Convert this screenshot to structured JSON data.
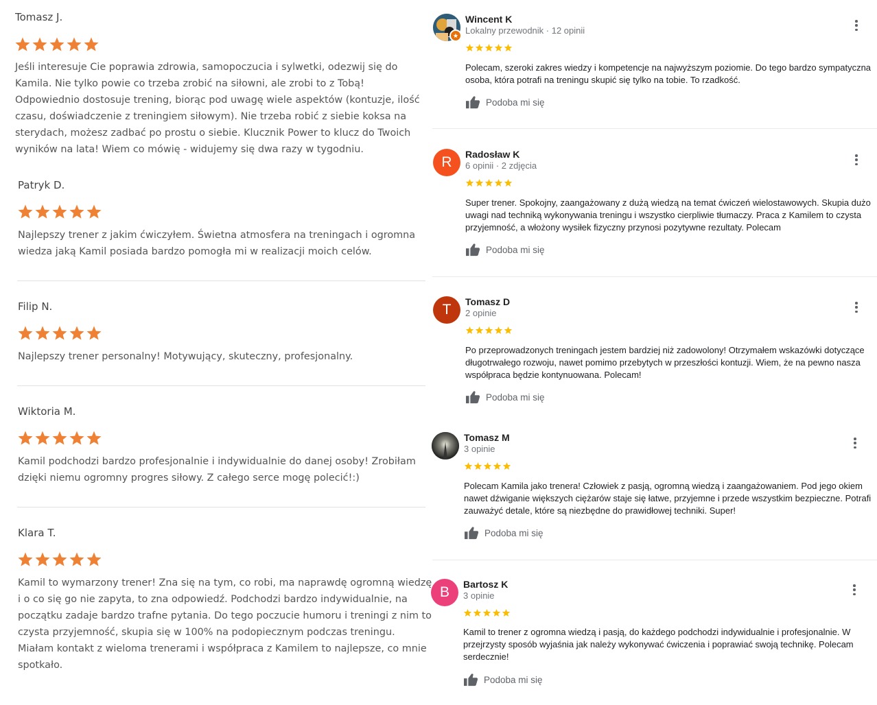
{
  "left_reviews": [
    {
      "name": "Tomasz J.",
      "rating": 5,
      "lines": [
        "Jeśli interesuje Cie poprawia zdrowia, samopoczucia i sylwetki, odezwij się do",
        "Kamila. Nie tylko powie co trzeba zrobić na siłowni, ale zrobi to z Tobą!",
        "Odpowiednio dostosuje trening, biorąc pod uwagę wiele aspektów (kontuzje, ilość",
        "czasu, doświadczenie z treningiem siłowym). Nie trzeba robić z siebie koksa na",
        "sterydach, możesz zadbać po prostu o siebie. Klucznik Power to klucz do Twoich",
        "wyników na lata! Wiem co mówię - widujemy się dwa razy w tygodniu."
      ]
    },
    {
      "name": "Patryk D.",
      "rating": 5,
      "lines": [
        "Najlepszy trener z jakim ćwiczyłem. Świetna atmosfera na treningach i ogromna",
        "wiedza jaką Kamil posiada bardzo pomogła mi w realizacji moich celów."
      ]
    },
    {
      "name": "Filip N.",
      "rating": 5,
      "lines": [
        "Najlepszy trener personalny! Motywujący, skuteczny, profesjonalny."
      ]
    },
    {
      "name": "Wiktoria M.",
      "rating": 5,
      "lines": [
        "Kamil podchodzi bardzo profesjonalnie i indywidualnie do danej osoby! Zrobiłam",
        "dzięki niemu ogromny progres siłowy. Z całego serce mogę polecić!:)"
      ]
    },
    {
      "name": "Klara T.",
      "rating": 5,
      "lines": [
        "Kamil to wymarzony trener! Zna się na tym, co robi, ma naprawdę ogromną wiedzę",
        "i o co się go nie zapyta, to zna odpowiedź. Podchodzi bardzo indywidualnie, na",
        "początku zadaje bardzo trafne pytania. Do tego poczucie humoru i treningi z nim to",
        "czysta przyjemność, skupia się w 100% na podopiecznym podczas treningu.",
        "Miałam kontakt z wieloma trenerami i współpraca z Kamilem to najlepsze, co mnie",
        "spotkało."
      ]
    }
  ],
  "right_reviews": [
    {
      "name": "Wincent K",
      "meta": "Lokalny przewodnik · 12 opinii",
      "avatar_letter": "",
      "avatar_color": "#3b6e8c",
      "rating": 5,
      "lines": [
        "Polecam, szeroki zakres wiedzy i kompetencje na najwyższym poziomie. Do tego bardzo sympatyczna",
        "osoba, która potrafi na treningu skupić się tylko na tobie. To rzadkość."
      ],
      "like_label": "Podoba mi się"
    },
    {
      "name": "Radosław K",
      "meta": "6 opinii · 2 zdjęcia",
      "avatar_letter": "R",
      "avatar_color": "#f4511e",
      "rating": 5,
      "lines": [
        "Super trener. Spokojny, zaangażowany z dużą wiedzą na temat ćwiczeń wielostawowych. Skupia dużo",
        "uwagi nad techniką wykonywania treningu i wszystko cierpliwie tłumaczy. Praca z Kamilem to czysta",
        "przyjemność, a włożony wysiłek fizyczny przynosi pozytywne rezultaty. Polecam"
      ],
      "like_label": "Podoba mi się"
    },
    {
      "name": "Tomasz D",
      "meta": "2 opinie",
      "avatar_letter": "T",
      "avatar_color": "#bf360c",
      "rating": 5,
      "lines": [
        "Po przeprowadzonych treningach jestem bardziej niż zadowolony! Otrzymałem wskazówki dotyczące",
        "długotrwałego rozwoju, nawet pomimo przebytych w przeszłości kontuzji. Wiem, że na pewno nasza",
        "współpraca będzie kontynuowana. Polecam!"
      ],
      "like_label": "Podoba mi się"
    },
    {
      "name": "Tomasz M",
      "meta": "3 opinie",
      "avatar_letter": "",
      "avatar_color": "#2b2b2b",
      "rating": 5,
      "lines": [
        "Polecam Kamila jako trenera! Człowiek z pasją, ogromną wiedzą i zaangażowaniem. Pod jego okiem",
        "nawet dźwiganie większych ciężarów staje się łatwe, przyjemne i przede wszystkim bezpieczne. Potrafi",
        "zauważyć detale, które są niezbędne do prawidłowej techniki. Super!"
      ],
      "like_label": "Podoba mi się"
    },
    {
      "name": "Bartosz K",
      "meta": "3 opinie",
      "avatar_letter": "B",
      "avatar_color": "#ec407a",
      "rating": 5,
      "lines": [
        "Kamil to trener z ogromna wiedzą i pasją, do każdego podchodzi indywidualnie i profesjonalnie. W",
        "przejrzysty sposób wyjaśnia jak należy wykonywać ćwiczenia i poprawiać swoją technikę. Polecam",
        "serdecznie!"
      ],
      "like_label": "Podoba mi się"
    }
  ],
  "colors": {
    "left_star": "#ee8133",
    "right_star": "#fbbc04",
    "icon_gray": "#5f6368"
  },
  "icons": {
    "star": "star-icon",
    "like": "thumbs-up-icon",
    "menu": "more-vert-icon",
    "local_guide_badge": "local-guide-badge-icon"
  }
}
